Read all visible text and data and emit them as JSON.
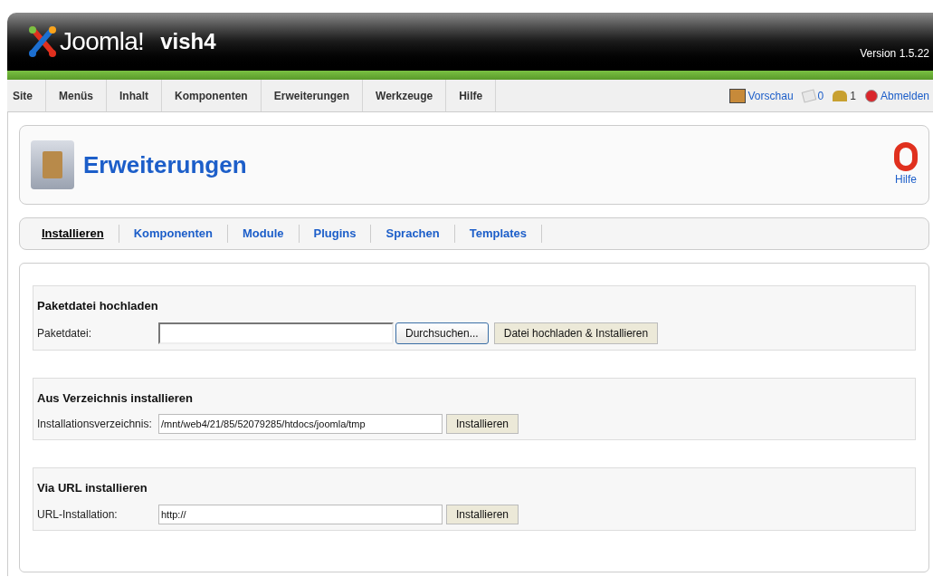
{
  "header": {
    "logo_text": "Joomla!",
    "site_name": "vish4",
    "version": "Version 1.5.22"
  },
  "menu": [
    {
      "label": "Site"
    },
    {
      "label": "Menüs"
    },
    {
      "label": "Inhalt"
    },
    {
      "label": "Komponenten"
    },
    {
      "label": "Erweiterungen"
    },
    {
      "label": "Werkzeuge"
    },
    {
      "label": "Hilfe"
    }
  ],
  "status": {
    "preview": "Vorschau",
    "messages": "0",
    "users": "1",
    "logout": "Abmelden"
  },
  "toolbar": {
    "title": "Erweiterungen",
    "help": "Hilfe"
  },
  "submenu": [
    {
      "label": "Installieren",
      "selected": true
    },
    {
      "label": "Komponenten",
      "selected": false
    },
    {
      "label": "Module",
      "selected": false
    },
    {
      "label": "Plugins",
      "selected": false
    },
    {
      "label": "Sprachen",
      "selected": false
    },
    {
      "label": "Templates",
      "selected": false
    }
  ],
  "sections": [
    {
      "kind": "file",
      "title": "Paketdatei hochladen",
      "label": "Paketdatei:",
      "browse": "Durchsuchen...",
      "button": "Datei hochladen & Installieren"
    },
    {
      "kind": "text",
      "title": "Aus Verzeichnis installieren",
      "label": "Installationsverzeichnis:",
      "value": "/mnt/web4/21/85/52079285/htdocs/joomla/tmp",
      "button": "Installieren"
    },
    {
      "kind": "text",
      "title": "Via URL installieren",
      "label": "URL-Installation:",
      "value": "http://",
      "button": "Installieren"
    }
  ]
}
